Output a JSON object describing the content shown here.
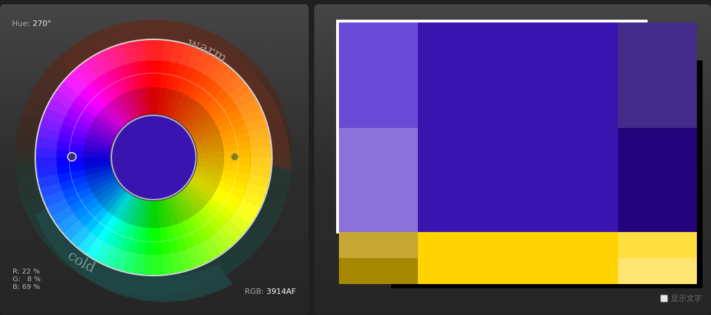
{
  "hue": {
    "label": "Hue:",
    "value": "270°"
  },
  "rgb_breakdown": {
    "r": "R: 22 %",
    "g": "G:   8 %",
    "b": "B: 69 %"
  },
  "hex": {
    "label": "RGB:",
    "value": "3914AF"
  },
  "wheel": {
    "warm_label": "warm",
    "cold_label": "cold",
    "center_color": "#3914AF"
  },
  "scheme": {
    "primary": "#3914AF",
    "secondary_light": "#6A4BD7",
    "secondary_lighter": "#8B72DA",
    "dark_1": "#432C8A",
    "dark_2": "#22037B",
    "complement": "#FFD300",
    "complement_dark_1": "#C6A732",
    "complement_dark_2": "#A68800",
    "complement_light_1": "#FFDE40",
    "complement_light_2": "#FFE673"
  },
  "controls": {
    "show_text_label": "显示文字"
  }
}
